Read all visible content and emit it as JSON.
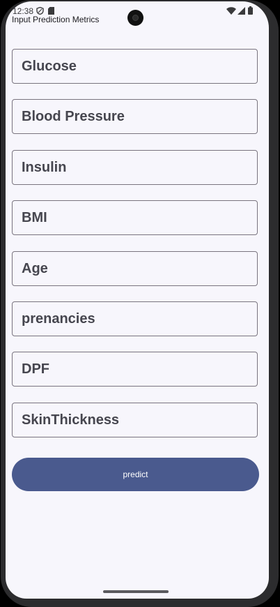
{
  "status_bar": {
    "time": "12:38",
    "icons": [
      "shield-icon",
      "sd-card-icon",
      "wifi-icon",
      "signal-icon",
      "battery-icon"
    ]
  },
  "app": {
    "title": "Input Prediction Metrics"
  },
  "form": {
    "fields": [
      {
        "placeholder": "Glucose"
      },
      {
        "placeholder": "Blood Pressure"
      },
      {
        "placeholder": "Insulin"
      },
      {
        "placeholder": "BMI"
      },
      {
        "placeholder": "Age"
      },
      {
        "placeholder": "prenancies"
      },
      {
        "placeholder": "DPF"
      },
      {
        "placeholder": "SkinThickness"
      }
    ],
    "predict_label": "predict"
  },
  "colors": {
    "background": "#f7f6fc",
    "button": "#4a5a8e",
    "field_border": "#79747e",
    "field_text": "#46464f"
  }
}
